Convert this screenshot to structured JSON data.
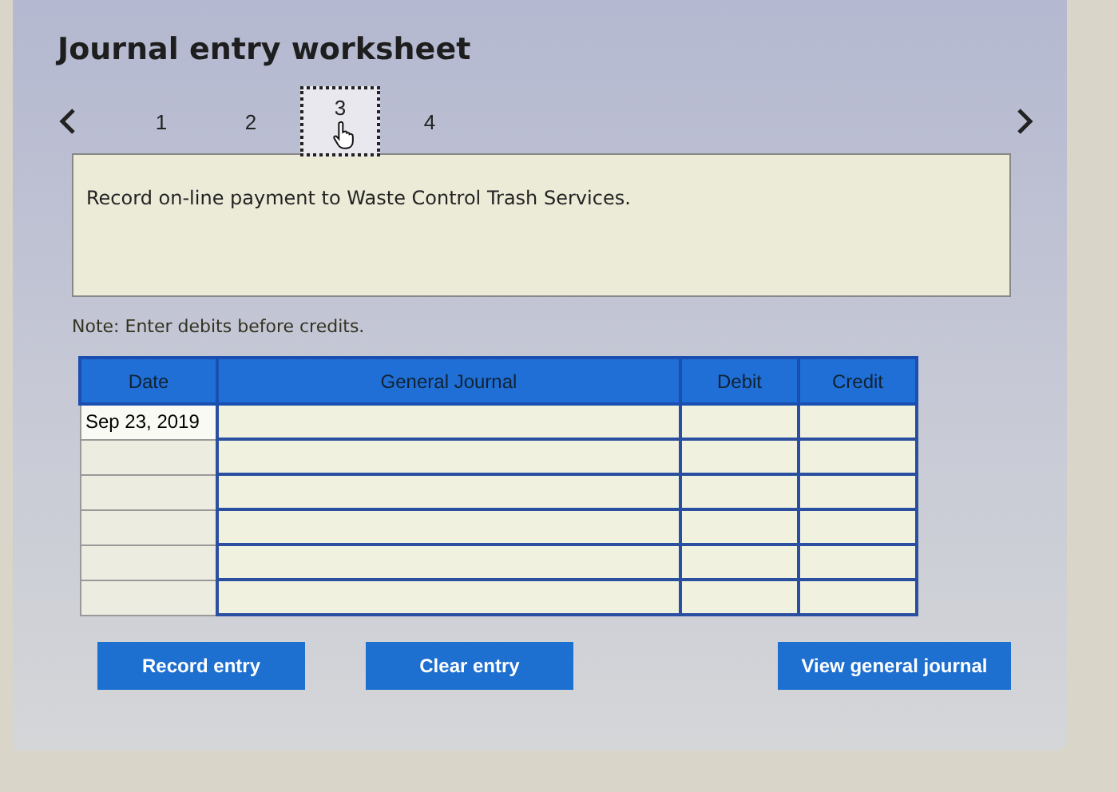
{
  "title": "Journal entry worksheet",
  "steps": [
    {
      "label": "1",
      "selected": false
    },
    {
      "label": "2",
      "selected": false
    },
    {
      "label": "3",
      "selected": true
    },
    {
      "label": "4",
      "selected": false
    }
  ],
  "description": "Record on-line payment to Waste Control Trash Services.",
  "note": "Note: Enter debits before credits.",
  "table": {
    "columns": [
      "Date",
      "General Journal",
      "Debit",
      "Credit"
    ],
    "rows": [
      {
        "date": "Sep 23, 2019"
      },
      {},
      {},
      {},
      {},
      {}
    ]
  },
  "buttons": [
    "Record entry",
    "Clear entry",
    "View general journal"
  ]
}
